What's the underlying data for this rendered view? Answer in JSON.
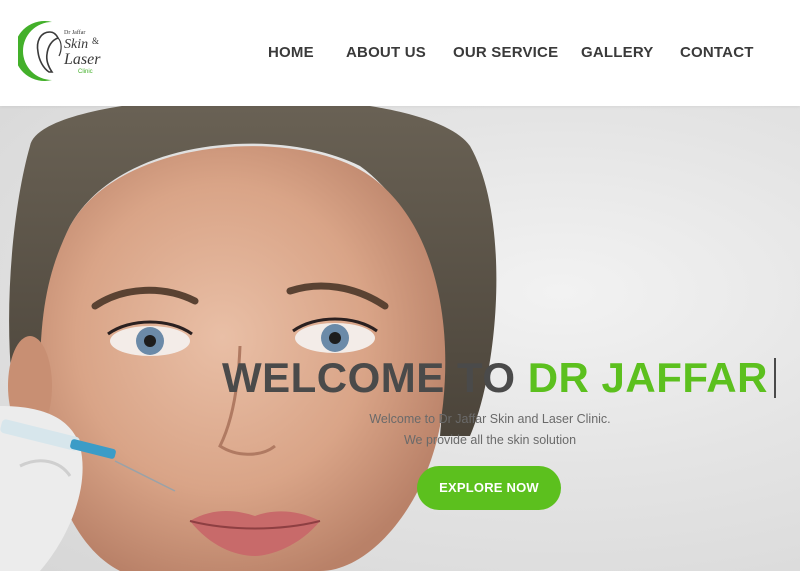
{
  "brand": {
    "logo_top_text": "Dr Jaffar",
    "logo_skin": "Skin",
    "logo_amp": "&",
    "logo_laser": "Laser",
    "logo_clinic": "Clinic",
    "accent_color": "#5cc01e"
  },
  "nav": {
    "items": [
      {
        "label": "HOME"
      },
      {
        "label": "ABOUT US"
      },
      {
        "label": "OUR SERVICE"
      },
      {
        "label": "GALLERY"
      },
      {
        "label": "CONTACT"
      }
    ]
  },
  "hero": {
    "title_prefix": "WELCOME TO ",
    "title_accent": "DR JAFFAR",
    "subtitle_line1": "Welcome to Dr Jaffar Skin and Laser Clinic.",
    "subtitle_line2": "We provide all the skin solution",
    "cta_label": "EXPLORE NOW"
  }
}
